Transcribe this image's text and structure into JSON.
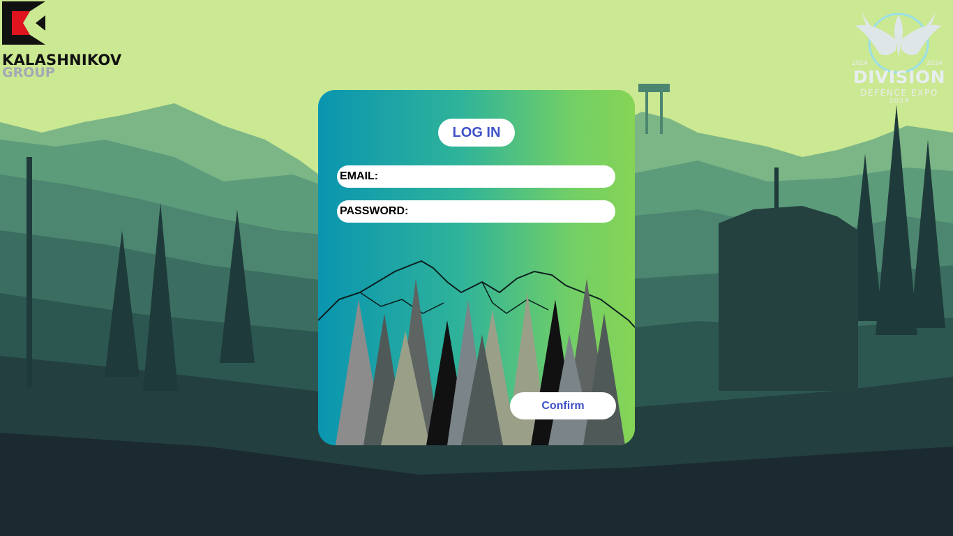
{
  "brand": {
    "name": "KALASHNIKOV",
    "sub": "GROUP"
  },
  "expo": {
    "title": "DIVISION",
    "subtitle": "DEFENCE EXPO",
    "year": "2024",
    "year_left": "2024",
    "year_right": "2024"
  },
  "login": {
    "title": "LOG IN",
    "email_label": "EMAIL:",
    "password_label": "PASSWORD:",
    "email_value": "",
    "password_value": "",
    "confirm_label": "Confirm"
  },
  "colors": {
    "accent": "#3f52c8",
    "sky": "#cbe892",
    "card_left": "#0a95b0",
    "card_right": "#86d456",
    "brand_red": "#e0141e"
  }
}
